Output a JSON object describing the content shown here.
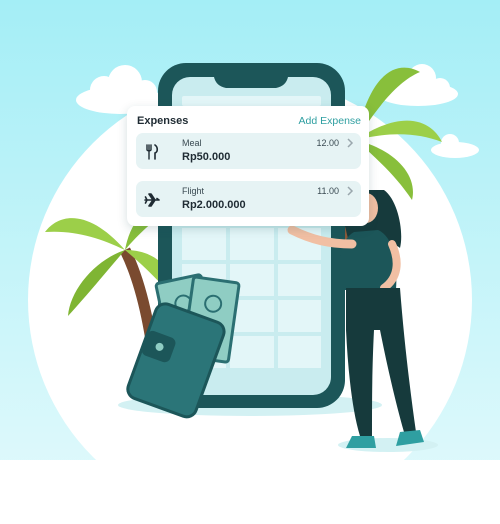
{
  "expenses_card": {
    "title": "Expenses",
    "add_label": "Add Expense",
    "items": [
      {
        "name": "Meal",
        "amount": "Rp50.000",
        "time": "12.00",
        "icon": "fork-knife-icon"
      },
      {
        "name": "Flight",
        "amount": "Rp2.000.000",
        "time": "11.00",
        "icon": "airplane-icon"
      }
    ]
  },
  "colors": {
    "sky": "#a9eef4",
    "phone_frame": "#1c5659",
    "phone_screen": "#c9ecef",
    "accent": "#2f9fa1",
    "palm_leaf": "#9ccf49",
    "wallet": "#2b7578",
    "banknote": "#8fcdc3"
  }
}
